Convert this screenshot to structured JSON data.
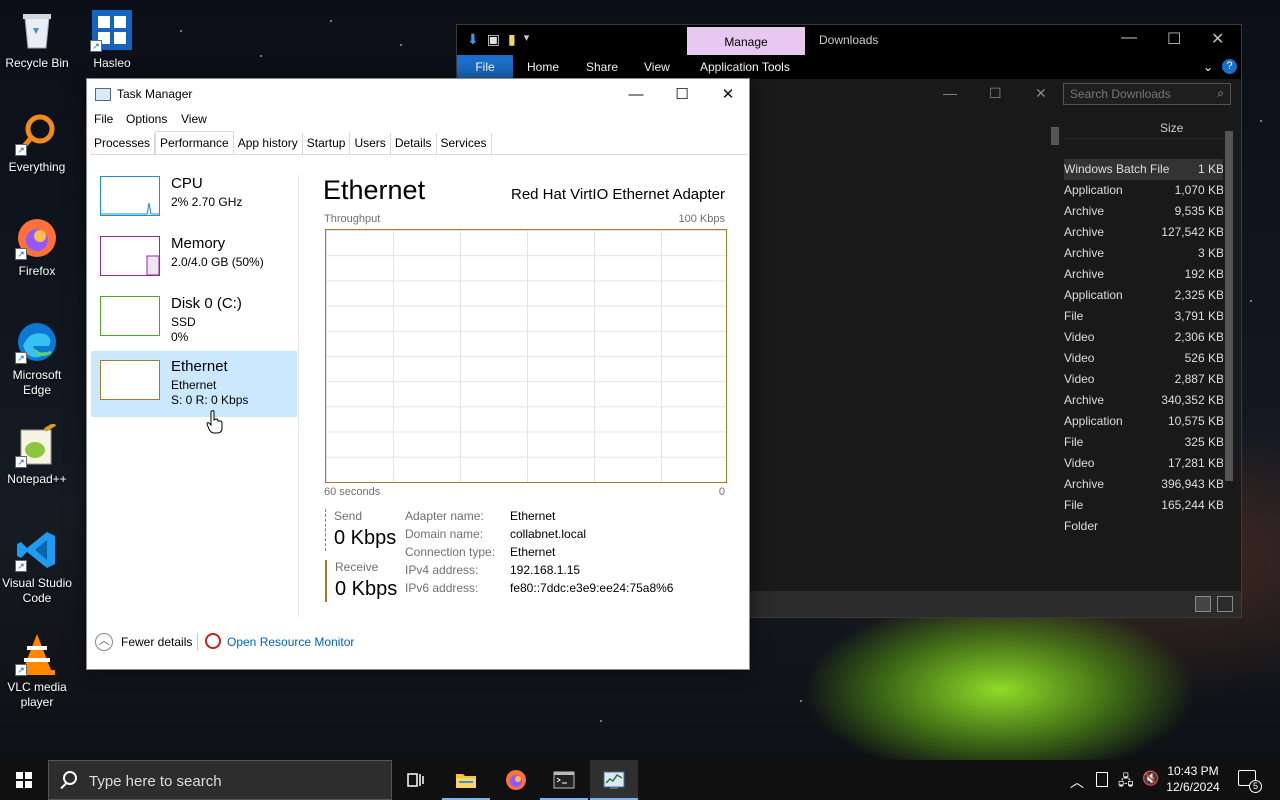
{
  "desktop": {
    "icons": [
      {
        "label": "Recycle Bin"
      },
      {
        "label": "Hasleo"
      },
      {
        "label": "Everything"
      },
      {
        "label": "Firefox"
      },
      {
        "label": "Microsoft Edge"
      },
      {
        "label": "Notepad++"
      },
      {
        "label": "Visual Studio Code"
      },
      {
        "label": "VLC media player"
      }
    ]
  },
  "explorer": {
    "context_tab": "Manage",
    "title": "Downloads",
    "ribbon": [
      "File",
      "Home",
      "Share",
      "View",
      "Application Tools"
    ],
    "search_placeholder": "Search Downloads",
    "column_size": "Size",
    "rows": [
      {
        "type": "Windows Batch File",
        "size": "1 KB"
      },
      {
        "type": "Application",
        "size": "1,070 KB"
      },
      {
        "type": "Archive",
        "size": "9,535 KB"
      },
      {
        "type": "Archive",
        "size": "127,542 KB"
      },
      {
        "type": "Archive",
        "size": "3 KB"
      },
      {
        "type": "Archive",
        "size": "192 KB"
      },
      {
        "type": "Application",
        "size": "2,325 KB"
      },
      {
        "type": "File",
        "size": "3,791 KB"
      },
      {
        "type": "Video",
        "size": "2,306 KB"
      },
      {
        "type": "Video",
        "size": "526 KB"
      },
      {
        "type": "Video",
        "size": "2,887 KB"
      },
      {
        "type": "Archive",
        "size": "340,352 KB"
      },
      {
        "type": "Application",
        "size": "10,575 KB"
      },
      {
        "type": "File",
        "size": "325 KB"
      },
      {
        "type": "Video",
        "size": "17,281 KB"
      },
      {
        "type": "Archive",
        "size": "396,943 KB"
      },
      {
        "type": "File",
        "size": "165,244 KB"
      },
      {
        "type": "Folder",
        "size": ""
      }
    ]
  },
  "task_manager": {
    "title": "Task Manager",
    "menu": [
      "File",
      "Options",
      "View"
    ],
    "tabs": [
      "Processes",
      "Performance",
      "App history",
      "Startup",
      "Users",
      "Details",
      "Services"
    ],
    "active_tab": "Performance",
    "resources": [
      {
        "name": "CPU",
        "line1": "2% 2.70 GHz",
        "line2": "",
        "color": "#1f8fd1"
      },
      {
        "name": "Memory",
        "line1": "2.0/4.0 GB (50%)",
        "line2": "",
        "color": "#8b2c9a"
      },
      {
        "name": "Disk 0 (C:)",
        "line1": "SSD",
        "line2": "0%",
        "color": "#4ea72a"
      },
      {
        "name": "Ethernet",
        "line1": "Ethernet",
        "line2": "S: 0 R: 0 Kbps",
        "color": "#a77b2a"
      }
    ],
    "detail": {
      "title": "Ethernet",
      "adapter": "Red Hat VirtIO Ethernet Adapter",
      "graph_label": "Throughput",
      "graph_max": "100 Kbps",
      "time_span": "60 seconds",
      "graph_min": "0",
      "send_label": "Send",
      "send_value": "0 Kbps",
      "receive_label": "Receive",
      "receive_value": "0 Kbps",
      "info": [
        {
          "key": "Adapter name:",
          "value": "Ethernet"
        },
        {
          "key": "Domain name:",
          "value": "collabnet.local"
        },
        {
          "key": "Connection type:",
          "value": "Ethernet"
        },
        {
          "key": "IPv4 address:",
          "value": "192.168.1.15"
        },
        {
          "key": "IPv6 address:",
          "value": "fe80::7ddc:e3e9:ee24:75a8%6"
        }
      ]
    },
    "footer": {
      "fewer_details": "Fewer details",
      "open_resource_monitor": "Open Resource Monitor"
    }
  },
  "taskbar": {
    "search_placeholder": "Type here to search",
    "time": "10:43 PM",
    "date": "12/6/2024",
    "notification_count": "5"
  },
  "colors": {
    "accent": "#1a6fc9",
    "ethernet": "#a77b2a",
    "selection": "#cce8ff"
  }
}
